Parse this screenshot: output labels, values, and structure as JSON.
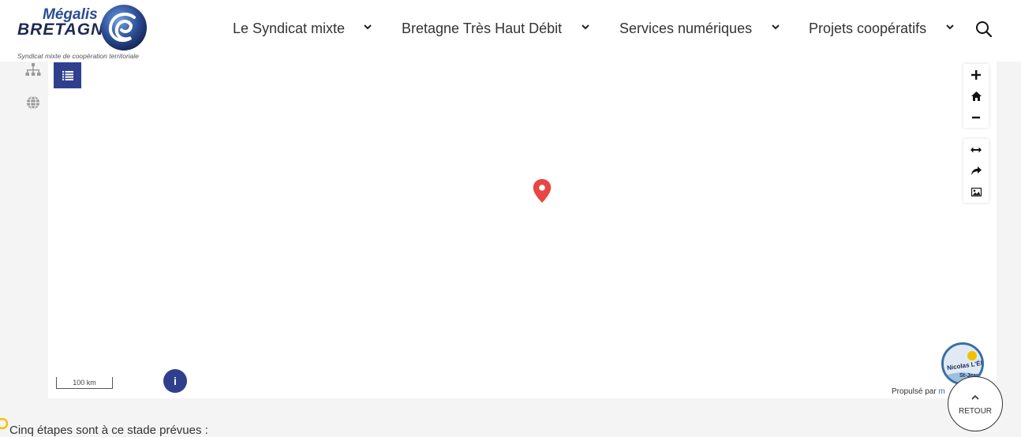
{
  "header": {
    "logo": {
      "name_top": "Mégalis",
      "name_bottom": "BRETAGNE",
      "tagline": "Syndicat mixte de coopération territoriale"
    },
    "nav": [
      {
        "label": "Le Syndicat mixte"
      },
      {
        "label": "Bretagne Très Haut Débit"
      },
      {
        "label": "Services numériques"
      },
      {
        "label": "Projets coopératifs"
      }
    ],
    "search_icon": "search-icon"
  },
  "sidebar": {
    "icons": [
      "sitemap-icon",
      "globe-icon"
    ]
  },
  "map": {
    "layers_button_icon": "list-icon",
    "controls": [
      "zoom-in-icon",
      "home-icon",
      "zoom-out-icon",
      "measure-icon",
      "share-icon",
      "image-export-icon"
    ],
    "marker_icon": "map-pin-icon",
    "marker_color": "#e84545",
    "scale_label": "100 km",
    "info_label": "i",
    "credit_text": "Propulsé par",
    "credit_link": "m",
    "avatar_text_top": "Nicolas L'Él",
    "avatar_text_bottom": "St-Jean"
  },
  "retour": {
    "label": "RETOUR"
  },
  "content": {
    "intro_text": "Cinq étapes sont à ce stade prévues :"
  },
  "colors": {
    "brand_blue": "#2f3f8e",
    "marker_red": "#e84545"
  }
}
